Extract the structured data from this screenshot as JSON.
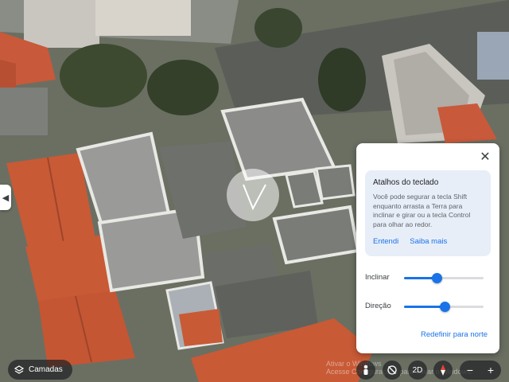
{
  "panel": {
    "tip_title": "Atalhos do teclado",
    "tip_body": "Você pode segurar a tecla Shift enquanto arrasta a Terra para inclinar e girar ou a tecla Control para olhar ao redor.",
    "tip_ok": "Entendi",
    "tip_more": "Saiba mais",
    "tilt_label": "Inclinar",
    "tilt_fraction": 0.41,
    "direction_label": "Direção",
    "direction_fraction": 0.51,
    "reset_label": "Redefinir para norte"
  },
  "bottom": {
    "layers_label": "Camadas",
    "mode_2d_label": "2D",
    "watermark_line1": "Ativar o Windows",
    "watermark_line2": "Acesse Configurações para ativar o Windows.",
    "zoom_out_label": "−",
    "zoom_in_label": "+"
  },
  "icons": {
    "close": "close-icon",
    "layers": "layers-icon",
    "pegman": "pegman-icon",
    "no_tilt": "tilt-icon",
    "compass": "compass-icon",
    "left_edge": "chevron-left-icon"
  },
  "colors": {
    "accent": "#1a73e8",
    "tip_background": "#e8eef8",
    "control_background": "#202124"
  }
}
